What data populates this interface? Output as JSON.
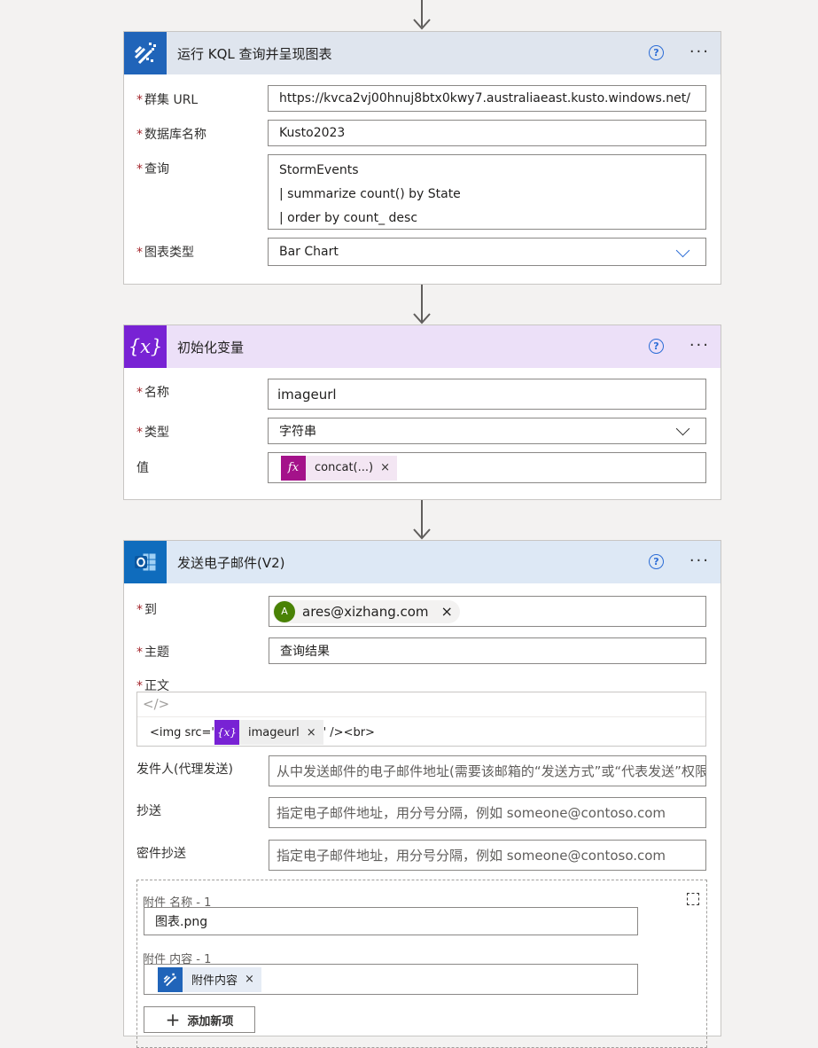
{
  "kql_card": {
    "title": "运行 KQL 查询并呈现图表",
    "fields": {
      "cluster_label": "群集 URL",
      "cluster_value": "https://kvca2vj00hnuj8btx0kwy7.australiaeast.kusto.windows.net/",
      "db_label": "数据库名称",
      "db_value": "Kusto2023",
      "query_label": "查询",
      "query_lines": [
        "StormEvents",
        "| summarize count() by State",
        "| order by  count_ desc"
      ],
      "charttype_label": "图表类型",
      "charttype_value": "Bar Chart"
    }
  },
  "var_card": {
    "title": "初始化变量",
    "icon_text": "{x}",
    "name_label": "名称",
    "name_value": "imageurl",
    "type_label": "类型",
    "type_value": "字符串",
    "value_label": "值",
    "value_token": "concat(...)",
    "fx": "fx"
  },
  "email_card": {
    "title": "发送电子邮件(V2)",
    "to_label": "到",
    "to_avatar": "A",
    "to_value": "ares@xizhang.com",
    "subject_label": "主题",
    "subject_value": "查询结果",
    "body_label": "正文",
    "code_glyph": "</>",
    "body_prefix": "<img src='",
    "body_token": "imageurl",
    "body_suffix": "' /><br>",
    "from_label": "发件人(代理发送)",
    "from_placeholder": "从中发送邮件的电子邮件地址(需要该邮箱的“发送方式”或“代表发送”权限)",
    "cc_label": "抄送",
    "cc_placeholder": "指定电子邮件地址，用分号分隔，例如 someone@contoso.com",
    "bcc_label": "密件抄送",
    "bcc_placeholder": "指定电子邮件地址，用分号分隔，例如 someone@contoso.com",
    "attach_name_label": "附件 名称 - 1",
    "attach_name_value": "图表.png",
    "attach_content_label": "附件 内容 - 1",
    "attach_content_token": "附件内容",
    "add_item_label": "添加新项"
  },
  "common": {
    "help": "?",
    "more": "···",
    "close": "×",
    "required": "*"
  },
  "colors": {
    "kql_blue": "#2064b9",
    "var_purple": "#7822d4",
    "outlook_blue": "#0f6cbd",
    "fx_magenta": "#a4128a"
  }
}
